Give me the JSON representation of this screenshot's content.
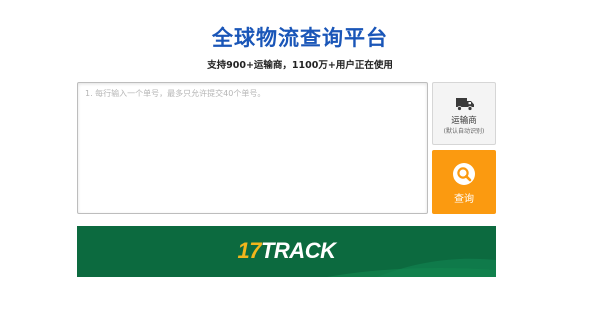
{
  "header": {
    "title": "全球物流查询平台",
    "subtitle": "支持900+运输商，1100万+用户正在使用"
  },
  "tracking_input": {
    "placeholder": "1. 每行输入一个单号，最多只允许提交40个单号。",
    "value": ""
  },
  "carrier_button": {
    "icon": "truck-icon",
    "label": "运输商",
    "hint": "(默认自动识别)"
  },
  "search_button": {
    "icon": "search-icon",
    "label": "查询"
  },
  "banner": {
    "logo_number": "17",
    "logo_text": "TRACK"
  },
  "colors": {
    "title": "#1a56b8",
    "search_button": "#fb9a10",
    "banner_bg": "#0c6a3f",
    "logo_accent": "#f2b51c"
  }
}
